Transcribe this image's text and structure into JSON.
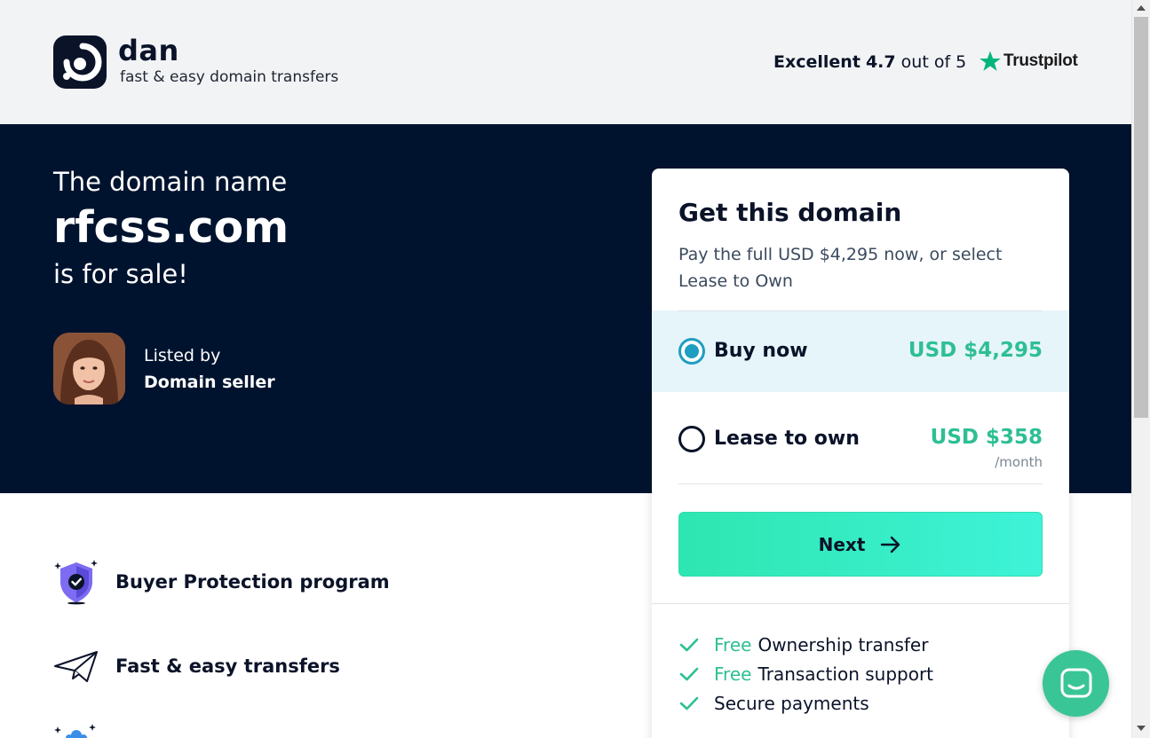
{
  "header": {
    "brand": "dan",
    "tagline": "fast & easy domain transfers",
    "rating_word": "Excellent",
    "rating_score": "4.7",
    "rating_suffix": "out of 5",
    "trustpilot": "Trustpilot",
    "star_color": "#00b67a"
  },
  "hero": {
    "line1": "The domain name",
    "domain": "rfcss.com",
    "line3": "is for sale!",
    "listed_by": "Listed by",
    "seller": "Domain seller"
  },
  "features": [
    {
      "label": "Buyer Protection program",
      "icon": "shield-check-icon"
    },
    {
      "label": "Fast & easy transfers",
      "icon": "paper-plane-icon"
    },
    {
      "label": "",
      "icon": "sparkle-icon"
    }
  ],
  "card": {
    "title": "Get this domain",
    "subtitle": "Pay the full USD $4,295 now, or select Lease to Own",
    "options": [
      {
        "label": "Buy now",
        "price": "USD $4,295",
        "selected": true
      },
      {
        "label": "Lease to own",
        "price": "USD $358",
        "per": "/month",
        "selected": false
      }
    ],
    "next_label": "Next",
    "perks": [
      {
        "free": "Free",
        "text": "Ownership transfer"
      },
      {
        "free": "Free",
        "text": "Transaction support"
      },
      {
        "free": "",
        "text": "Secure payments"
      }
    ]
  },
  "colors": {
    "navy": "#00132e",
    "accent_green": "#2ebf94",
    "selected_bg": "#e6f5fa",
    "radio_blue": "#1e9ec1",
    "chat_green": "#3ac597"
  }
}
